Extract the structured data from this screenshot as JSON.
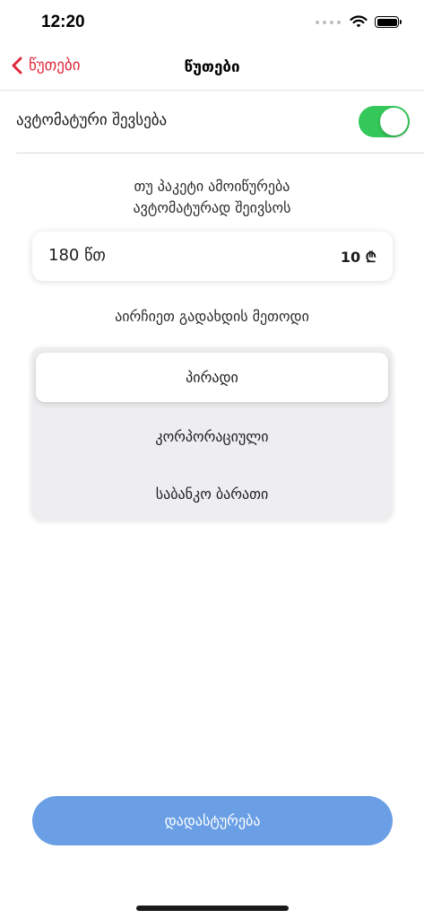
{
  "status_bar": {
    "time": "12:20"
  },
  "nav": {
    "back_label": "წუთები",
    "title": "წუთები"
  },
  "auto_renewal": {
    "label": "ავტომატური შევსება",
    "enabled": true,
    "color": "#34c759"
  },
  "description": {
    "line1": "თუ პაკეტი ამოიწურება",
    "line2": "ავტომატურად შეივსოს"
  },
  "package": {
    "minutes": "180 წთ",
    "price": "10 ₾"
  },
  "payment": {
    "heading": "აირჩიეთ გადახდის მეთოდი",
    "options": [
      "პირადი",
      "კორპორაციული",
      "საბანკო ბარათი"
    ],
    "selected": "პირადი"
  },
  "confirm_label": "დადასტურება",
  "colors": {
    "accent": "#e0283b",
    "button": "#6a9fe5",
    "toggle": "#34c759"
  }
}
